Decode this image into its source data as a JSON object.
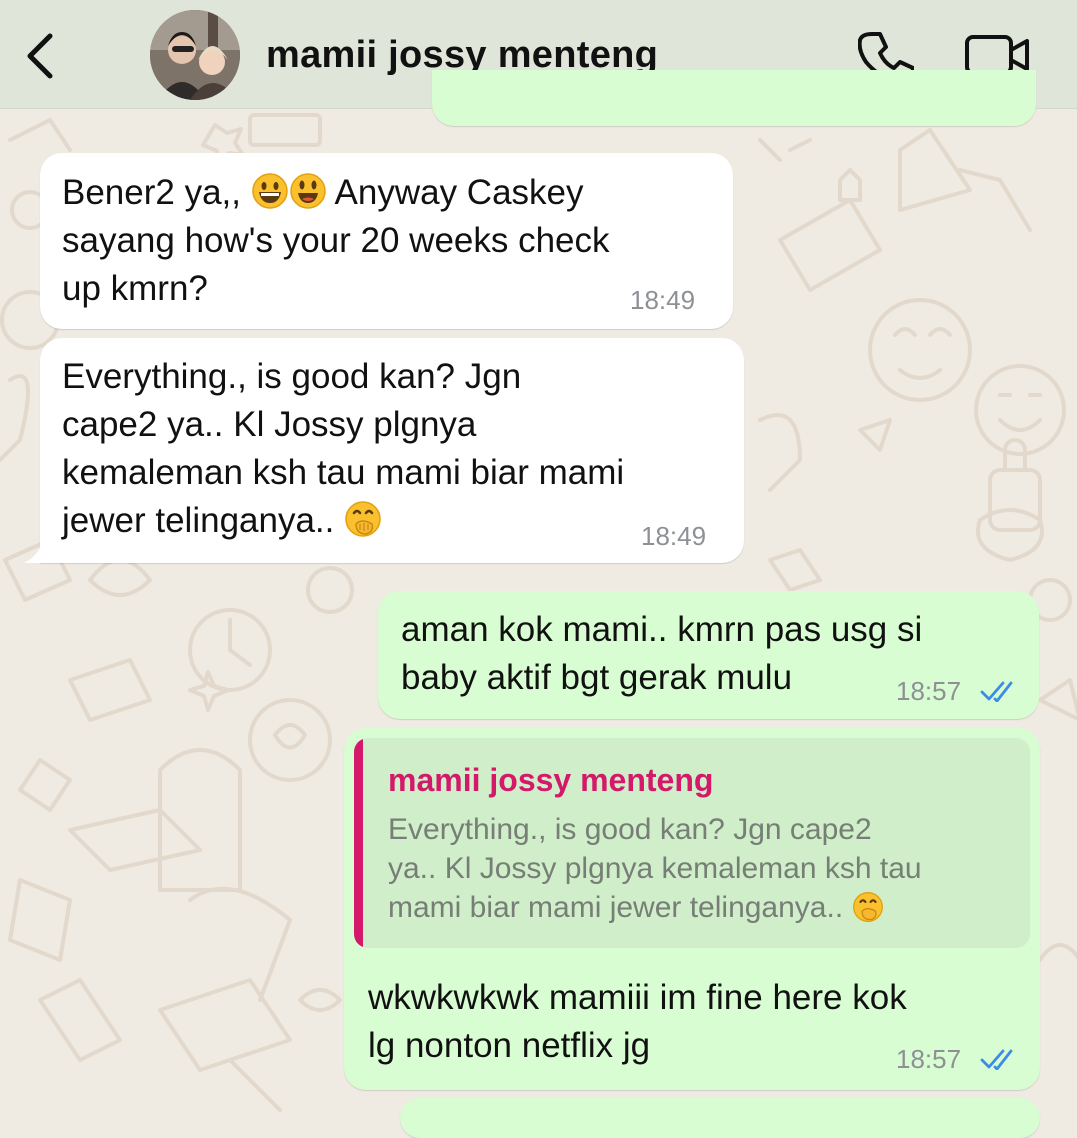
{
  "contact": {
    "name": "mamii jossy menteng"
  },
  "messages": [
    {
      "direction": "incoming",
      "text": "Bener2 ya,, 😀😃 Anyway Caskey sayang how's your 20 weeks check up kmrn?",
      "time": "18:49"
    },
    {
      "direction": "incoming",
      "text": "Everything., is good kan? Jgn cape2 ya.. Kl Jossy plgnya kemaleman ksh tau mami biar mami jewer telinganya.. 🤭",
      "time": "18:49"
    },
    {
      "direction": "outgoing",
      "text": "aman kok mami.. kmrn pas usg si baby aktif bgt gerak mulu",
      "time": "18:57",
      "status": "read"
    },
    {
      "direction": "outgoing",
      "reply_to": {
        "name": "mamii jossy menteng",
        "text": "Everything., is good kan? Jgn cape2 ya.. Kl Jossy plgnya kemaleman ksh tau mami biar mami jewer telinganya.. 🤭"
      },
      "text": "wkwkwkwk mamiii im fine here kok lg nonton netflix jg",
      "time": "18:57",
      "status": "read"
    }
  ],
  "display": {
    "m1_l1": "Bener2 ya,, ",
    "m1_l1b": " Anyway Caskey",
    "m1_l2": "sayang how's your 20 weeks check",
    "m1_l3": "up kmrn?",
    "m2_l1": "Everything., is good kan? Jgn",
    "m2_l2": "cape2 ya.. Kl Jossy plgnya",
    "m2_l3": "kemaleman ksh tau mami biar mami",
    "m2_l4": "jewer telinganya.. ",
    "m3_l1": "aman kok mami.. kmrn pas usg si",
    "m3_l2": "baby aktif bgt gerak mulu",
    "q_l1": "Everything., is good kan? Jgn cape2",
    "q_l2": "ya.. Kl Jossy plgnya kemaleman ksh tau",
    "q_l3": "mami biar mami jewer telinganya.. ",
    "m4_l1": "wkwkwkwk mamiii im fine here kok",
    "m4_l2": "lg nonton netflix jg"
  },
  "icons": {
    "back": "chevron-left-icon",
    "call": "phone-icon",
    "video": "video-camera-icon",
    "read": "double-check-icon",
    "emoji_grin": "grinning-face",
    "emoji_smile": "smiling-face-open-mouth",
    "emoji_hand": "face-with-hand-over-mouth"
  },
  "colors": {
    "header_bg": "#dfe6d9",
    "chat_bg": "#efeae2",
    "incoming_bubble": "#ffffff",
    "outgoing_bubble": "#d9fdd3",
    "quote_accent": "#d4196a",
    "read_ticks": "#3b8bea"
  }
}
